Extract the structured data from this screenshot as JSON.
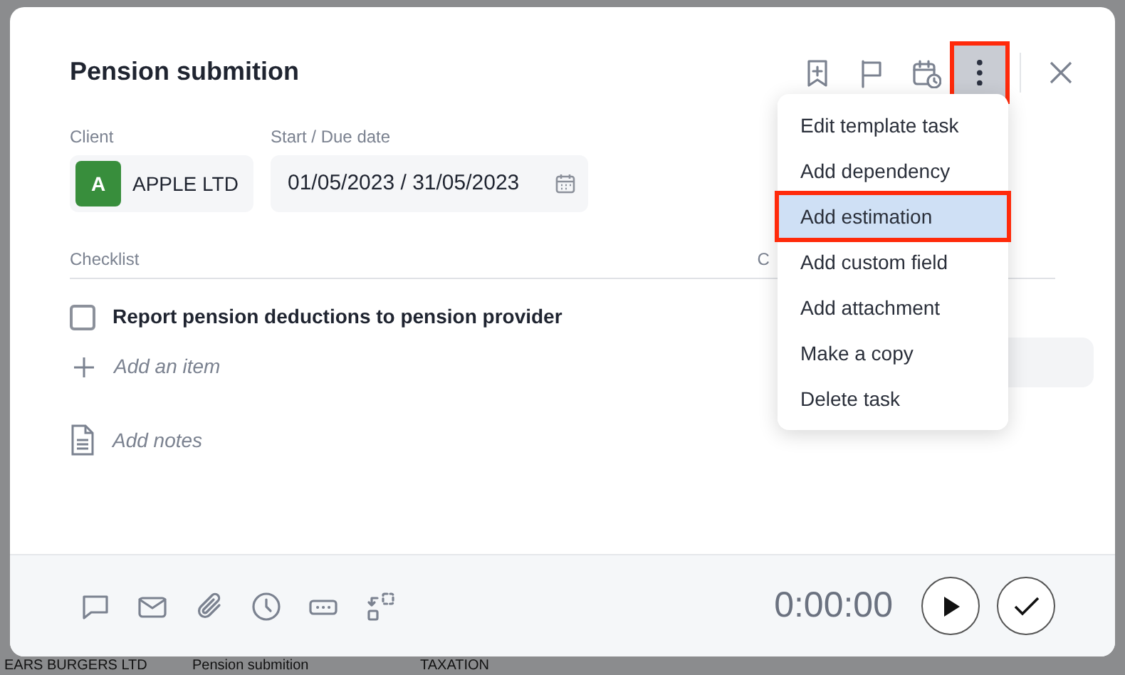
{
  "backdrop": {
    "row": [
      "EARS BURGERS LTD",
      "Pension submition",
      "TAXATION"
    ]
  },
  "modal": {
    "title": "Pension submition",
    "header_actions": [
      {
        "kind": "bookmark"
      },
      {
        "kind": "flag"
      },
      {
        "kind": "schedule"
      },
      {
        "kind": "more",
        "selected": true,
        "highlighted": true
      }
    ],
    "client": {
      "label": "Client",
      "initial": "A",
      "color": "#388e3c",
      "name": "APPLE LTD"
    },
    "dates": {
      "label": "Start / Due date",
      "value": "01/05/2023 / 31/05/2023"
    },
    "checklist": {
      "label": "Checklist",
      "column_2_label": "C",
      "items": [
        {
          "text": "Report pension deductions to pension provider",
          "checked": false
        }
      ],
      "add_placeholder": "Add an item"
    },
    "notes_placeholder": "Add notes",
    "footer_tools": [
      {
        "kind": "comment"
      },
      {
        "kind": "mail"
      },
      {
        "kind": "attach"
      },
      {
        "kind": "clock"
      },
      {
        "kind": "dots"
      },
      {
        "kind": "convert"
      }
    ],
    "timer": "0:00:00"
  },
  "menu": {
    "items": [
      {
        "label": "Edit template task",
        "selected": false,
        "highlighted": false
      },
      {
        "label": "Add dependency",
        "selected": false,
        "highlighted": false
      },
      {
        "label": "Add estimation",
        "selected": true,
        "highlighted": true
      },
      {
        "label": "Add custom field",
        "selected": false,
        "highlighted": false
      },
      {
        "label": "Add attachment",
        "selected": false,
        "highlighted": false
      },
      {
        "label": "Make a copy",
        "selected": false,
        "highlighted": false
      },
      {
        "label": "Delete task",
        "selected": false,
        "highlighted": false
      }
    ]
  }
}
